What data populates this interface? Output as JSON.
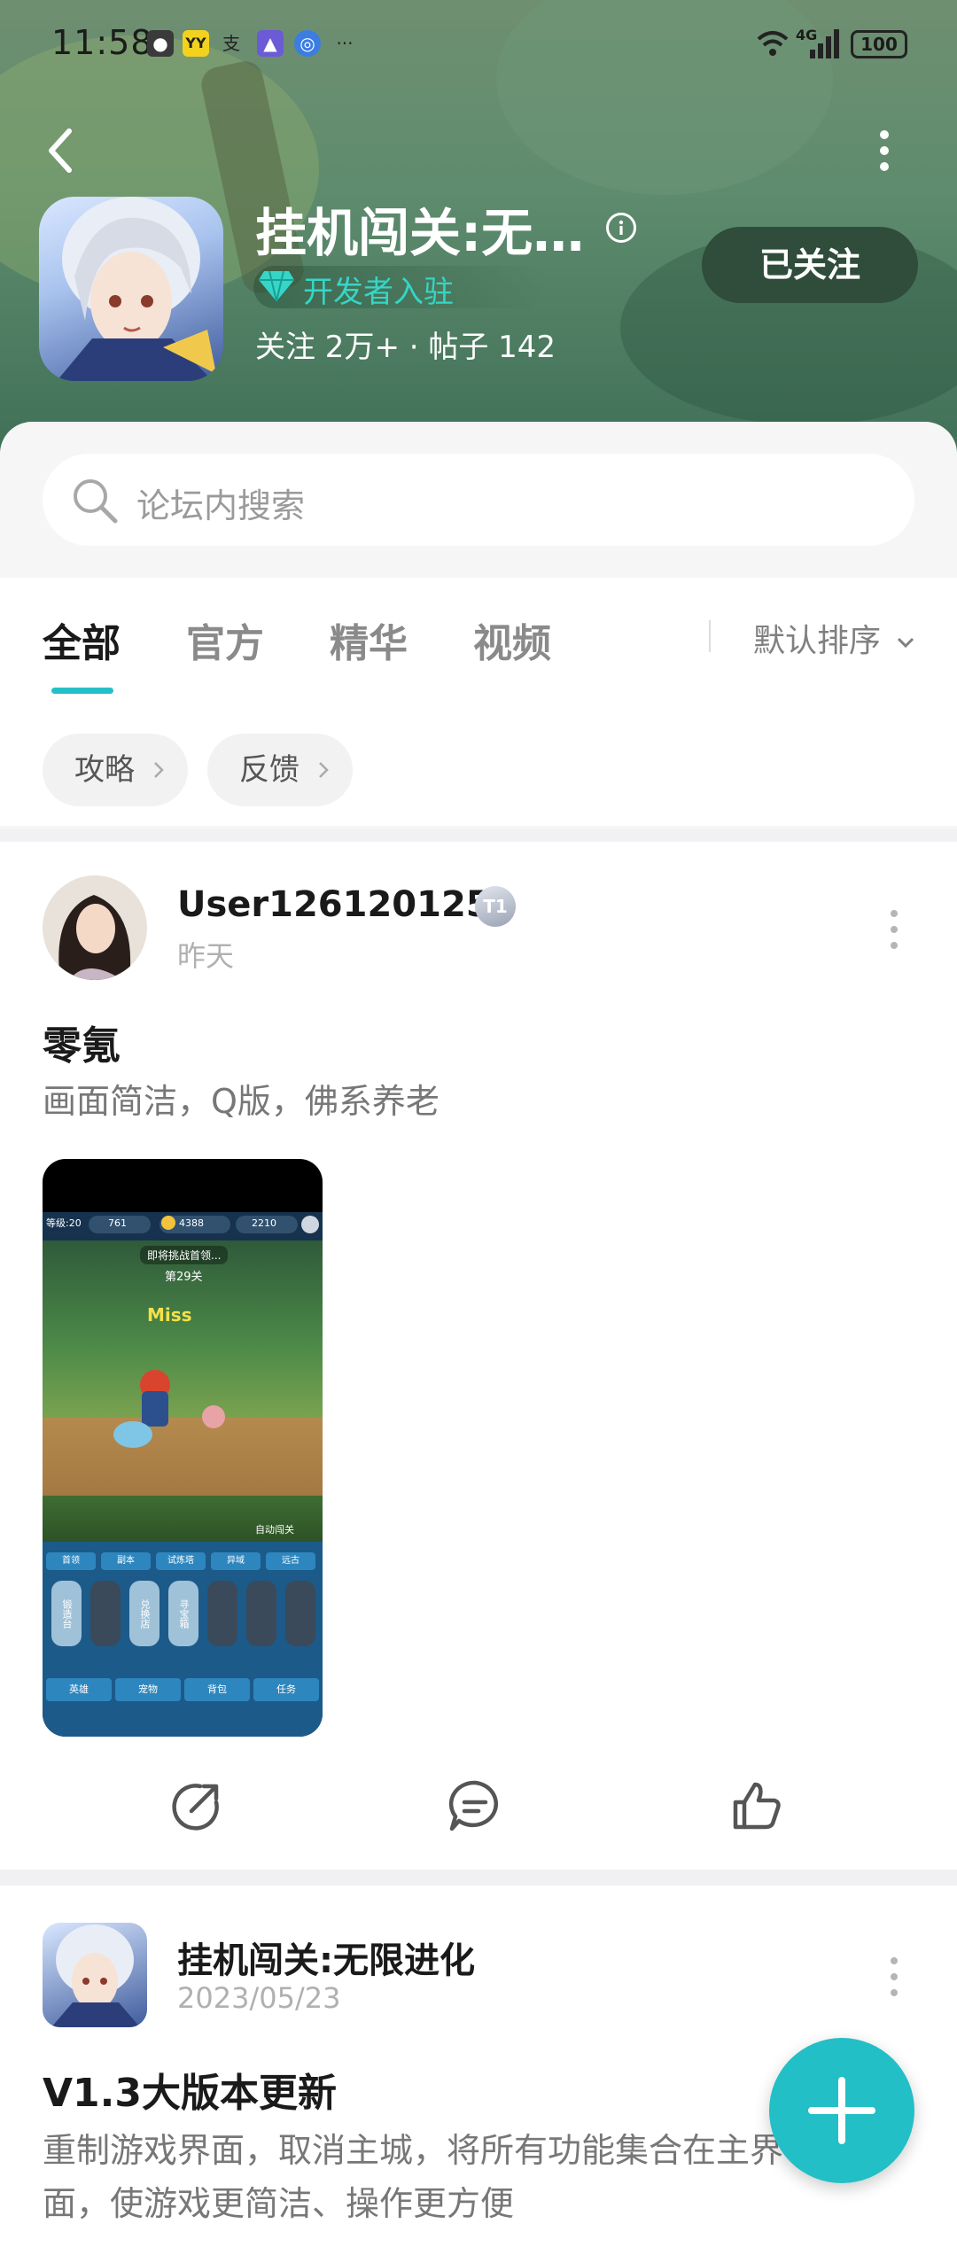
{
  "status_bar": {
    "time": "11:58",
    "battery": "100",
    "network": "4G"
  },
  "header": {
    "app_title": "挂机闯关:无…",
    "developer_badge": "开发者入驻",
    "stats": "关注 2万+ · 帖子 142",
    "follow_button": "已关注"
  },
  "search": {
    "placeholder": "论坛内搜索"
  },
  "tabs": [
    {
      "label": "全部",
      "active": true
    },
    {
      "label": "官方",
      "active": false
    },
    {
      "label": "精华",
      "active": false
    },
    {
      "label": "视频",
      "active": false
    }
  ],
  "sort": {
    "label": "默认排序"
  },
  "chips": [
    {
      "label": "攻略"
    },
    {
      "label": "反馈"
    }
  ],
  "posts": [
    {
      "username": "User126120125",
      "level_badge": "T1",
      "date": "昨天",
      "title": "零氪",
      "description": "画面简洁，Q版，佛系养老",
      "image": {
        "level": "等级:20",
        "gold": "4388",
        "gems": "2210",
        "stamina": "761",
        "banner": "即将挑战首领...",
        "stage": "第29关",
        "miss": "Miss",
        "auto": "自动闯关",
        "menu_top": [
          "首领",
          "副本",
          "试炼塔",
          "异域",
          "远古"
        ],
        "menu_mid": [
          "锻造台",
          "兑换店",
          "寻宝箱"
        ],
        "menu_bottom": [
          "英雄",
          "宠物",
          "背包",
          "任务"
        ]
      }
    },
    {
      "username": "挂机闯关:无限进化",
      "date": "2023/05/23",
      "title": "V1.3大版本更新",
      "description_line1": "重制游戏界面，取消主城，将所有功能集合在主界",
      "description_line2": "面，使游戏更简洁、操作更方便"
    }
  ],
  "colors": {
    "accent": "#22bfc6",
    "follow_bg": "#2f4d3a",
    "header_green": "#5f8c6e"
  }
}
